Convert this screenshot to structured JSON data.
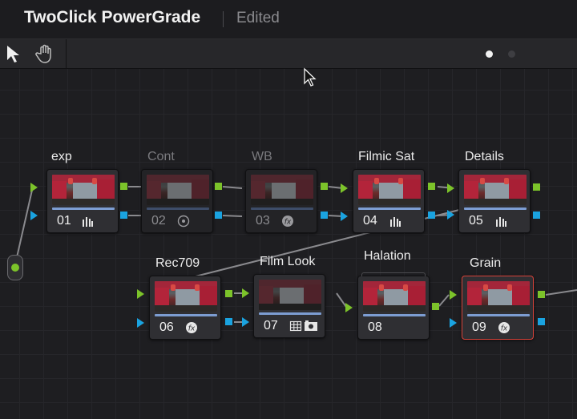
{
  "window": {
    "title": "TwoClick PowerGrade",
    "status": "Edited"
  },
  "toolbar": {
    "tools": [
      "pointer-tool",
      "hand-tool"
    ],
    "page_dots": 2,
    "active_page": 1
  },
  "colors": {
    "input_port": "#7cc32a",
    "key_port": "#1aa3e0",
    "selected_border": "#d9433a",
    "progress_bar": "#7d9dd2"
  },
  "nodes": [
    {
      "id": "01",
      "label": "exp",
      "icon": "histogram-icon",
      "disabled": false
    },
    {
      "id": "02",
      "label": "Cont",
      "icon": "target-icon",
      "disabled": true
    },
    {
      "id": "03",
      "label": "WB",
      "icon": "fx-icon",
      "disabled": true
    },
    {
      "id": "04",
      "label": "Filmic Sat",
      "icon": "histogram-icon",
      "disabled": false
    },
    {
      "id": "05",
      "label": "Details",
      "icon": "histogram-icon",
      "disabled": false
    },
    {
      "id": "06",
      "label": "Rec709",
      "icon": "fx-icon",
      "disabled": false
    },
    {
      "id": "07",
      "label": "Film Look",
      "icon": "grid-camera-icon",
      "disabled": false
    },
    {
      "id": "08",
      "label": "Halation",
      "icon": "",
      "disabled": false,
      "stacked": true
    },
    {
      "id": "09",
      "label": "Grain",
      "icon": "fx-icon",
      "disabled": false,
      "selected": true
    }
  ]
}
